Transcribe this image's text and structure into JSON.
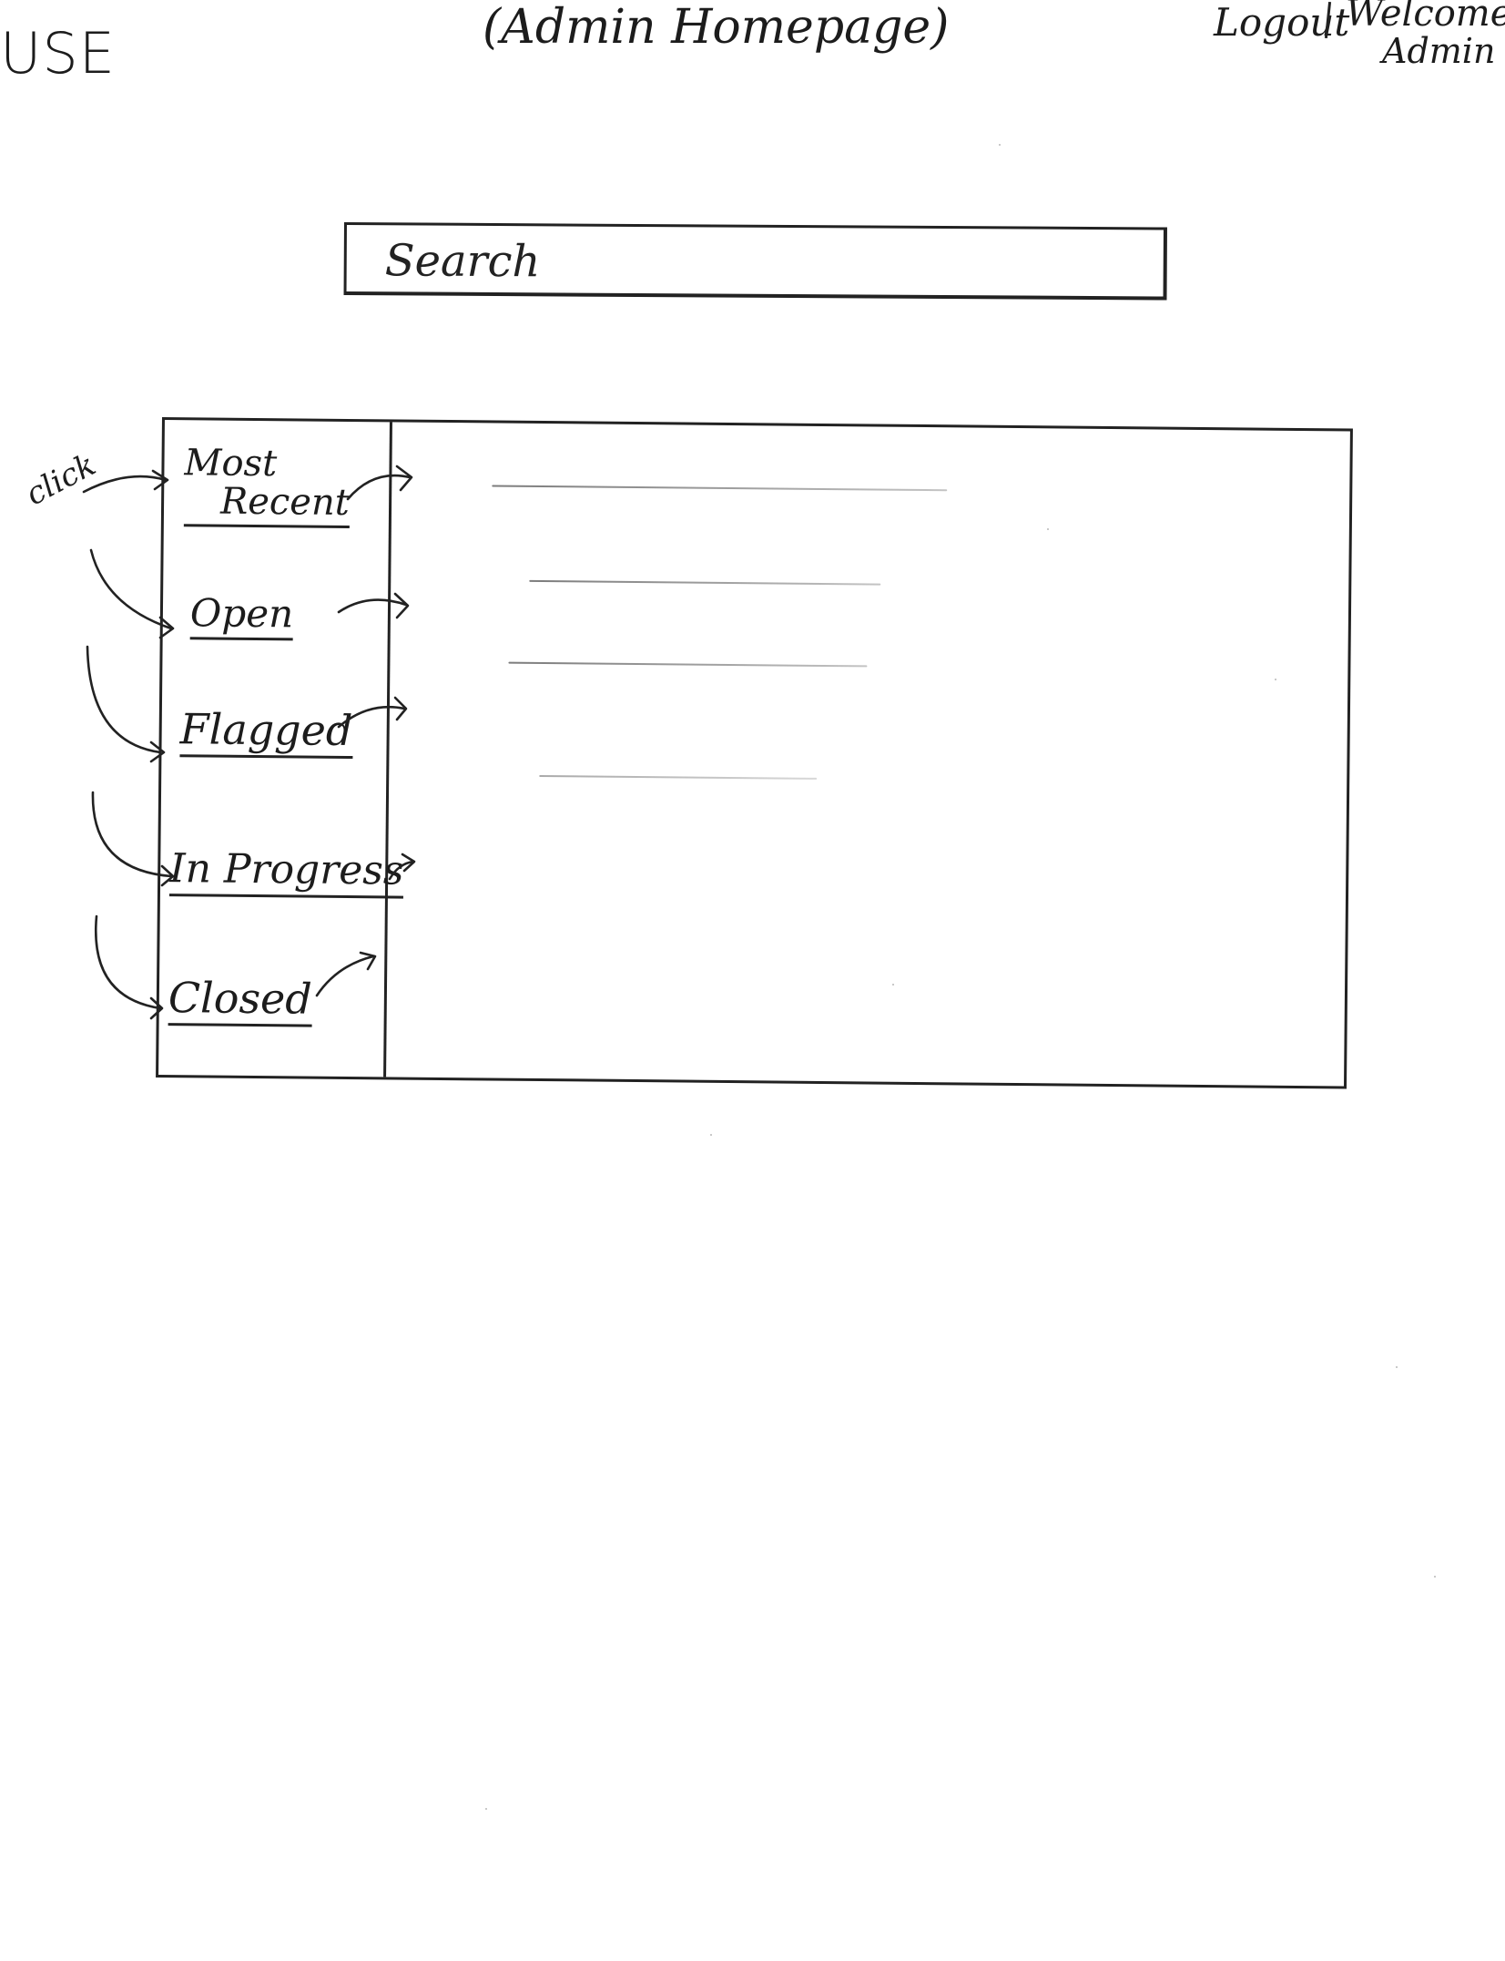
{
  "header": {
    "logo": "USE",
    "page_title": "(Admin Homepage)",
    "logout_label": "Logout",
    "welcome_line1": "Welcome",
    "welcome_line2": "Admin"
  },
  "search": {
    "placeholder": "Search"
  },
  "sidebar": {
    "items": [
      {
        "label_line1": "Most",
        "label_line2": "Recent"
      },
      {
        "label": "Open"
      },
      {
        "label": "Flagged"
      },
      {
        "label": "In Progress"
      },
      {
        "label": "Closed"
      }
    ]
  },
  "annotations": {
    "click_note": "click"
  }
}
